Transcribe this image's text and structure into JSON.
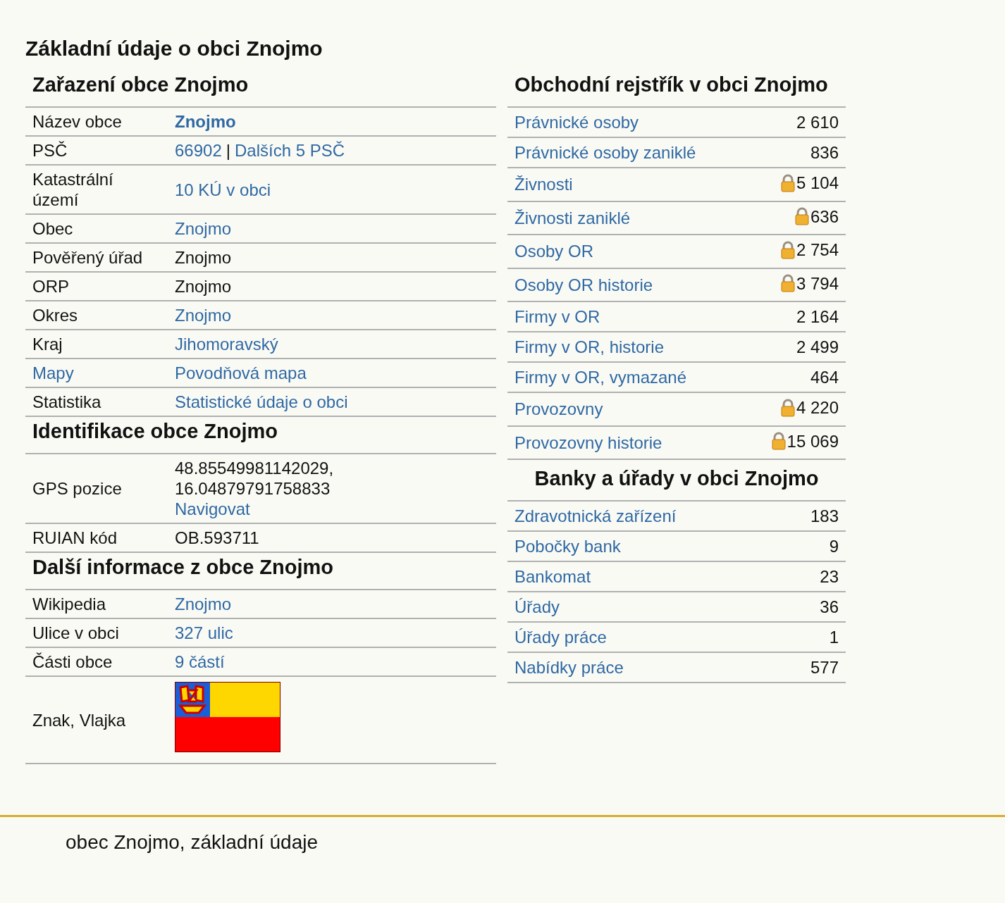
{
  "title": "Základní údaje o obci Znojmo",
  "left_sections": [
    {
      "heading": "Zařazení obce Znojmo",
      "rows": [
        {
          "label": {
            "text": "Název obce",
            "link": false
          },
          "kind": "text",
          "lines": [
            [
              {
                "text": "Znojmo",
                "kind": "strong-link"
              }
            ]
          ]
        },
        {
          "label": {
            "text": "PSČ",
            "link": false
          },
          "kind": "text",
          "lines": [
            [
              {
                "text": "66902",
                "kind": "link"
              },
              {
                "text": "|",
                "kind": "text"
              },
              {
                "text": "Dalších 5 PSČ",
                "kind": "link"
              }
            ]
          ]
        },
        {
          "label": {
            "text": "Katastrální území",
            "link": false
          },
          "kind": "text",
          "lines": [
            [
              {
                "text": "10 KÚ v obci",
                "kind": "link"
              }
            ]
          ]
        },
        {
          "label": {
            "text": "Obec",
            "link": false
          },
          "kind": "text",
          "lines": [
            [
              {
                "text": "Znojmo",
                "kind": "link"
              }
            ]
          ]
        },
        {
          "label": {
            "text": "Pověřený úřad",
            "link": false
          },
          "kind": "text",
          "lines": [
            [
              {
                "text": "Znojmo",
                "kind": "text"
              }
            ]
          ]
        },
        {
          "label": {
            "text": "ORP",
            "link": false
          },
          "kind": "text",
          "lines": [
            [
              {
                "text": "Znojmo",
                "kind": "text"
              }
            ]
          ]
        },
        {
          "label": {
            "text": "Okres",
            "link": false
          },
          "kind": "text",
          "lines": [
            [
              {
                "text": "Znojmo",
                "kind": "link"
              }
            ]
          ]
        },
        {
          "label": {
            "text": "Kraj",
            "link": false
          },
          "kind": "text",
          "lines": [
            [
              {
                "text": "Jihomoravský",
                "kind": "link"
              }
            ]
          ]
        },
        {
          "label": {
            "text": "Mapy",
            "link": true
          },
          "kind": "text",
          "lines": [
            [
              {
                "text": "Povodňová mapa",
                "kind": "link"
              }
            ]
          ]
        },
        {
          "label": {
            "text": "Statistika",
            "link": false
          },
          "kind": "text",
          "lines": [
            [
              {
                "text": "Statistické údaje o obci",
                "kind": "link"
              }
            ]
          ]
        }
      ]
    },
    {
      "heading": "Identifikace obce Znojmo",
      "rows": [
        {
          "label": {
            "text": "GPS pozice",
            "link": false
          },
          "kind": "text",
          "lines": [
            [
              {
                "text": "48.85549981142029,",
                "kind": "text"
              }
            ],
            [
              {
                "text": "16.04879791758833",
                "kind": "text"
              }
            ],
            [
              {
                "text": "Navigovat",
                "kind": "link"
              }
            ]
          ]
        },
        {
          "label": {
            "text": "RUIAN kód",
            "link": false
          },
          "kind": "text",
          "lines": [
            [
              {
                "text": "OB.593711",
                "kind": "text"
              }
            ]
          ]
        }
      ]
    },
    {
      "heading": "Další informace z obce Znojmo",
      "rows": [
        {
          "label": {
            "text": "Wikipedia",
            "link": false
          },
          "kind": "text",
          "lines": [
            [
              {
                "text": "Znojmo",
                "kind": "link"
              }
            ]
          ]
        },
        {
          "label": {
            "text": "Ulice v obci",
            "link": false
          },
          "kind": "text",
          "lines": [
            [
              {
                "text": "327 ulic",
                "kind": "link"
              }
            ]
          ]
        },
        {
          "label": {
            "text": "Části obce",
            "link": false
          },
          "kind": "text",
          "lines": [
            [
              {
                "text": "9 částí",
                "kind": "link"
              }
            ]
          ]
        },
        {
          "label": {
            "text": "Znak, Vlajka",
            "link": false
          },
          "kind": "flag"
        }
      ]
    }
  ],
  "right_sections": [
    {
      "heading": "Obchodní rejstřík v obci Znojmo",
      "rows": [
        {
          "label": "Právnické osoby",
          "value": "2 610",
          "locked": false
        },
        {
          "label": "Právnické osoby zaniklé",
          "value": "836",
          "locked": false
        },
        {
          "label": "Živnosti",
          "value": "5 104",
          "locked": true
        },
        {
          "label": "Živnosti zaniklé",
          "value": "636",
          "locked": true
        },
        {
          "label": "Osoby OR",
          "value": "2 754",
          "locked": true
        },
        {
          "label": "Osoby OR historie",
          "value": "3 794",
          "locked": true
        },
        {
          "label": "Firmy v OR",
          "value": "2 164",
          "locked": false
        },
        {
          "label": "Firmy v OR, historie",
          "value": "2 499",
          "locked": false
        },
        {
          "label": "Firmy v OR, vymazané",
          "value": "464",
          "locked": false
        },
        {
          "label": "Provozovny",
          "value": "4 220",
          "locked": true
        },
        {
          "label": "Provozovny historie",
          "value": "15 069",
          "locked": true
        }
      ]
    },
    {
      "heading": "Banky a úřady v obci Znojmo",
      "rows": [
        {
          "label": "Zdravotnická zařízení",
          "value": "183",
          "locked": false
        },
        {
          "label": "Pobočky bank",
          "value": "9",
          "locked": false
        },
        {
          "label": "Bankomat",
          "value": "23",
          "locked": false
        },
        {
          "label": "Úřady",
          "value": "36",
          "locked": false
        },
        {
          "label": "Úřady práce",
          "value": "1",
          "locked": false
        },
        {
          "label": "Nabídky práce",
          "value": "577",
          "locked": false
        }
      ]
    }
  ],
  "footer": "obec Znojmo, základní údaje"
}
